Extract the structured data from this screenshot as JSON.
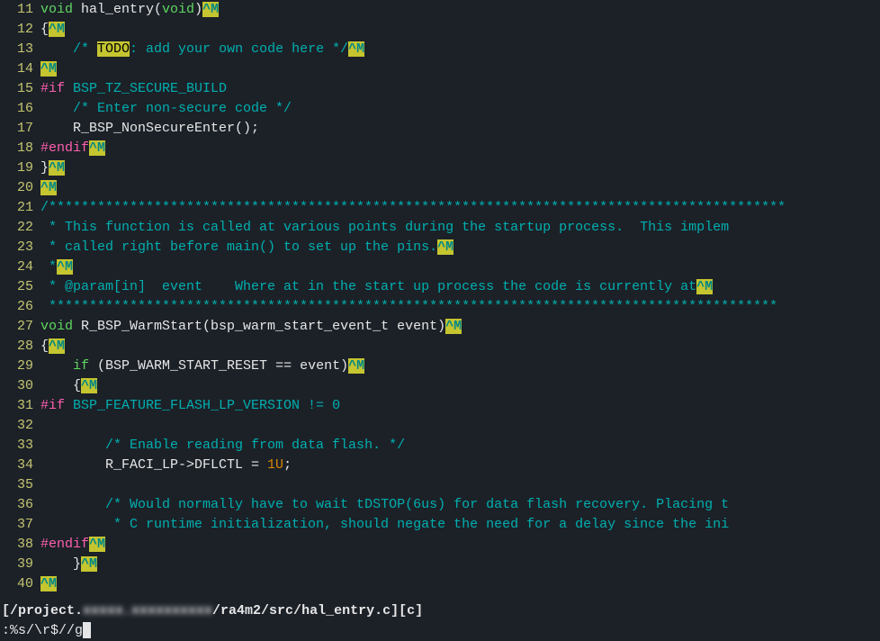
{
  "lines": [
    {
      "n": "11",
      "seg": [
        {
          "t": "void",
          "c": "kw-type"
        },
        {
          "t": " hal_entry(",
          "c": "fn"
        },
        {
          "t": "void",
          "c": "kw-type"
        },
        {
          "t": ")",
          "c": "fn"
        },
        {
          "t": "^M",
          "c": "cr"
        }
      ]
    },
    {
      "n": "12",
      "seg": [
        {
          "t": "{",
          "c": "fn"
        },
        {
          "t": "^M",
          "c": "cr"
        }
      ]
    },
    {
      "n": "13",
      "seg": [
        {
          "t": "    ",
          "c": "fn"
        },
        {
          "t": "/* ",
          "c": "comment"
        },
        {
          "t": "TODO",
          "c": "todo-hl"
        },
        {
          "t": ": add your own code here */",
          "c": "comment"
        },
        {
          "t": "^M",
          "c": "cr"
        }
      ]
    },
    {
      "n": "14",
      "seg": [
        {
          "t": "^M",
          "c": "cr"
        }
      ]
    },
    {
      "n": "15",
      "seg": [
        {
          "t": "#if",
          "c": "define"
        },
        {
          "t": " BSP_TZ_SECURE_BUILD",
          "c": "define-name"
        }
      ]
    },
    {
      "n": "16",
      "seg": [
        {
          "t": "    ",
          "c": "fn"
        },
        {
          "t": "/* Enter non-secure code */",
          "c": "comment"
        }
      ]
    },
    {
      "n": "17",
      "seg": [
        {
          "t": "    R_BSP_NonSecureEnter();",
          "c": "fn"
        }
      ]
    },
    {
      "n": "18",
      "seg": [
        {
          "t": "#endif",
          "c": "define"
        },
        {
          "t": "^M",
          "c": "cr"
        }
      ]
    },
    {
      "n": "19",
      "seg": [
        {
          "t": "}",
          "c": "fn"
        },
        {
          "t": "^M",
          "c": "cr"
        }
      ]
    },
    {
      "n": "20",
      "seg": [
        {
          "t": "^M",
          "c": "cr"
        }
      ]
    },
    {
      "n": "21",
      "seg": [
        {
          "t": "/*******************************************************************************************",
          "c": "comment"
        }
      ]
    },
    {
      "n": "22",
      "seg": [
        {
          "t": " * This function is called at various points during the startup process.  This implem",
          "c": "comment"
        }
      ]
    },
    {
      "n": "23",
      "seg": [
        {
          "t": " * called right before main() to set up the pins.",
          "c": "comment"
        },
        {
          "t": "^M",
          "c": "cr"
        }
      ]
    },
    {
      "n": "24",
      "seg": [
        {
          "t": " *",
          "c": "comment"
        },
        {
          "t": "^M",
          "c": "cr"
        }
      ]
    },
    {
      "n": "25",
      "seg": [
        {
          "t": " * @param[in]  event    Where at in the start up process the code is currently at",
          "c": "comment"
        },
        {
          "t": "^M",
          "c": "cr"
        }
      ]
    },
    {
      "n": "26",
      "seg": [
        {
          "t": " ******************************************************************************************",
          "c": "comment"
        }
      ]
    },
    {
      "n": "27",
      "seg": [
        {
          "t": "void",
          "c": "kw-type"
        },
        {
          "t": " R_BSP_WarmStart(bsp_warm_start_event_t event)",
          "c": "fn"
        },
        {
          "t": "^M",
          "c": "cr"
        }
      ]
    },
    {
      "n": "28",
      "seg": [
        {
          "t": "{",
          "c": "fn"
        },
        {
          "t": "^M",
          "c": "cr"
        }
      ]
    },
    {
      "n": "29",
      "seg": [
        {
          "t": "    ",
          "c": "fn"
        },
        {
          "t": "if",
          "c": "kw-type"
        },
        {
          "t": " (BSP_WARM_START_RESET == event)",
          "c": "fn"
        },
        {
          "t": "^M",
          "c": "cr"
        }
      ]
    },
    {
      "n": "30",
      "seg": [
        {
          "t": "    {",
          "c": "fn"
        },
        {
          "t": "^M",
          "c": "cr"
        }
      ]
    },
    {
      "n": "31",
      "seg": [
        {
          "t": "#if",
          "c": "define"
        },
        {
          "t": " BSP_FEATURE_FLASH_LP_VERSION != 0",
          "c": "define-name"
        }
      ]
    },
    {
      "n": "32",
      "seg": []
    },
    {
      "n": "33",
      "seg": [
        {
          "t": "        ",
          "c": "fn"
        },
        {
          "t": "/* Enable reading from data flash. */",
          "c": "comment"
        }
      ]
    },
    {
      "n": "34",
      "seg": [
        {
          "t": "        R_FACI_LP->DFLCTL = ",
          "c": "fn"
        },
        {
          "t": "1U",
          "c": "num"
        },
        {
          "t": ";",
          "c": "fn"
        }
      ]
    },
    {
      "n": "35",
      "seg": []
    },
    {
      "n": "36",
      "seg": [
        {
          "t": "        ",
          "c": "fn"
        },
        {
          "t": "/* Would normally have to wait tDSTOP(6us) for data flash recovery. Placing t",
          "c": "comment"
        }
      ]
    },
    {
      "n": "37",
      "seg": [
        {
          "t": "         * C runtime initialization, should negate the need for a delay since the ini",
          "c": "comment"
        }
      ]
    },
    {
      "n": "38",
      "seg": [
        {
          "t": "#endif",
          "c": "define"
        },
        {
          "t": "^M",
          "c": "cr"
        }
      ]
    },
    {
      "n": "39",
      "seg": [
        {
          "t": "    }",
          "c": "fn"
        },
        {
          "t": "^M",
          "c": "cr"
        }
      ]
    },
    {
      "n": "40",
      "seg": [
        {
          "t": "^M",
          "c": "cr"
        }
      ]
    }
  ],
  "status": {
    "prefix": "[/project.",
    "blurred": "xxxxx.xxxxxxxxxx",
    "suffix": "/ra4m2/src/hal_entry.c][c]"
  },
  "cmd": ":%s/\\r$//g"
}
